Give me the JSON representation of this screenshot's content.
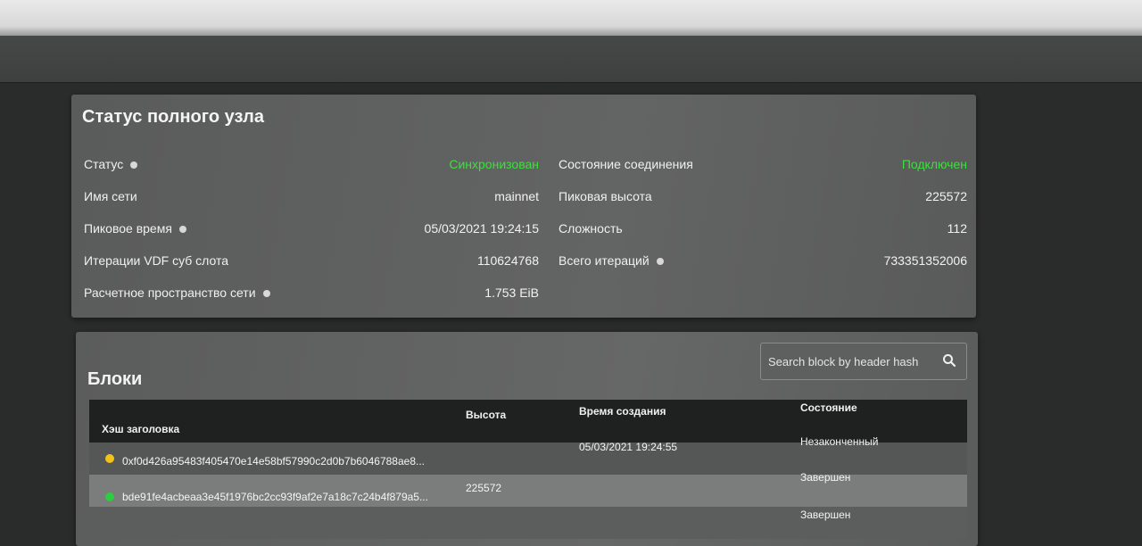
{
  "status": {
    "title": "Статус полного узла",
    "left_rows": [
      {
        "label": "Статус",
        "value": "Синхронизован",
        "help": true,
        "green": true
      },
      {
        "label": "Имя сети",
        "value": "mainnet",
        "help": false,
        "green": false
      },
      {
        "label": "Пиковое время",
        "value": "05/03/2021 19:24:15",
        "help": true,
        "green": false
      },
      {
        "label": "Итерации VDF суб слота",
        "value": "110624768",
        "help": false,
        "green": false
      },
      {
        "label": "Расчетное пространство сети",
        "value": "1.753 EiB",
        "help": true,
        "green": false
      }
    ],
    "right_rows": [
      {
        "label": "Состояние соединения",
        "value": "Подключен",
        "help": false,
        "green": true
      },
      {
        "label": "Пиковая высота",
        "value": "225572",
        "help": false,
        "green": false
      },
      {
        "label": "Сложность",
        "value": "112",
        "help": false,
        "green": false
      },
      {
        "label": "Всего итераций",
        "value": "733351352006",
        "help": true,
        "green": false
      }
    ]
  },
  "blocks": {
    "title": "Блоки",
    "search": {
      "placeholder": "Search block by header hash",
      "icon": "search-icon"
    },
    "columns": {
      "hash": "Хэш заголовка",
      "height": "Высота",
      "time": "Время создания",
      "state": "Состояние"
    },
    "rows": [
      {
        "hash": "0xf0d426a95483f405470e14e58bf57990c2d0b7b6046788ae8...",
        "height": "",
        "time": "05/03/2021 19:24:55",
        "state": "Незаконченный",
        "dot_color": "#f2c21b"
      },
      {
        "hash": "bde91fe4acbeaa3e45f1976bc2cc93f9af2e7a18c7c24b4f879a5...",
        "height": "225572",
        "time": "",
        "state": "Завершен",
        "dot_color": "#2ecc40"
      },
      {
        "hash": "",
        "height": "",
        "time": "",
        "state": "Завершен",
        "dot_color": ""
      }
    ]
  },
  "colors": {
    "green_status": "#3ce03c",
    "table_header": "#1f2020"
  }
}
